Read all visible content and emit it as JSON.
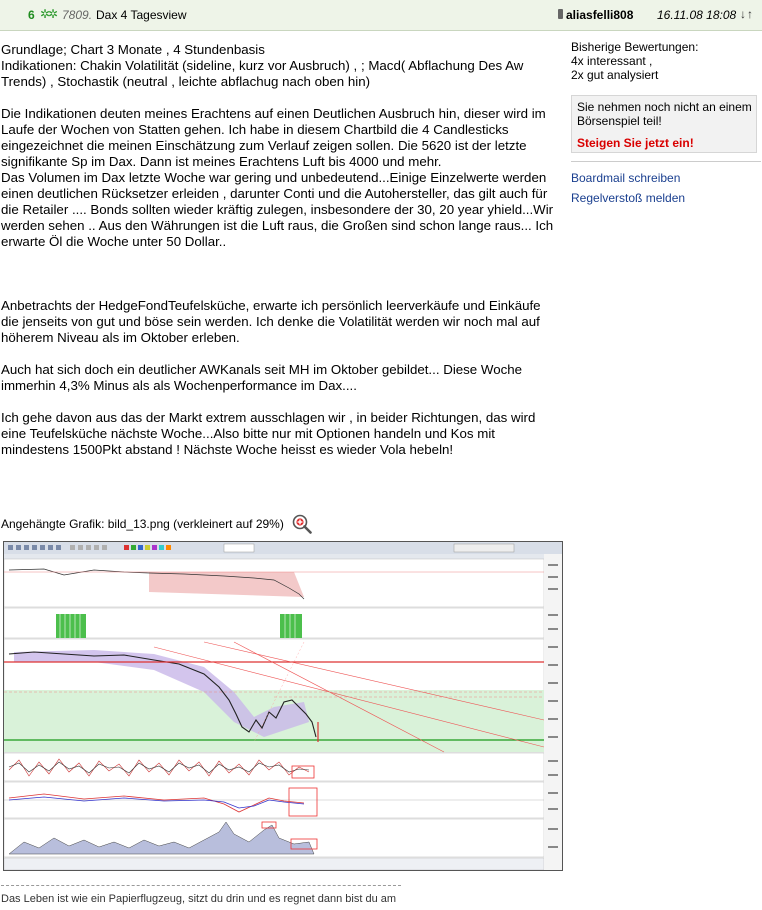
{
  "header": {
    "number": "6",
    "post_id": "7809.",
    "title": "Dax 4 Tagesview",
    "user": "aliasfelli808",
    "date": "16.11.08 18:08",
    "arrows": "↓↑"
  },
  "post": {
    "paragraphs": [
      "Grundlage; Chart 3 Monate , 4 Stundenbasis\nIndikationen: Chakin Volatilität (sideline, kurz vor Ausbruch) , ; Macd( Abflachung Des Aw Trends) , Stochastik (neutral , leichte abflachug nach oben hin)",
      "Die Indikationen deuten meines Erachtens auf einen Deutlichen Ausbruch hin, dieser wird im Laufe der Wochen von Statten gehen. Ich habe in diesem Chartbild die 4 Candlesticks eingezeichnet die meinen Einschätzung zum Verlauf zeigen sollen. Die 5620 ist der letzte signifikante Sp im Dax. Dann ist meines Erachtens Luft bis 4000 und mehr.\nDas Volumen im Dax letzte Woche war gering und unbedeutend...Einige Einzelwerte werden einen deutlichen Rücksetzer erleiden , darunter Conti und die Autohersteller, das gilt auch für die Retailer .... Bonds sollten wieder kräftig zulegen, insbesondere der 30, 20 year yhield...Wir werden sehen .. Aus den Währungen ist die Luft raus, die Großen sind schon lange raus... Ich erwarte Öl die Woche unter 50 Dollar..",
      "",
      "Anbetrachts der HedgeFondTeufelsküche, erwarte ich persönlich leerverkäufe und Einkäufe die jenseits von gut und böse sein werden. Ich denke die Volatilität werden wir noch mal auf höherem Niveau als im Oktober erleben.",
      "Auch hat sich doch ein deutlicher AWKanals seit MH im Oktober gebildet... Diese Woche immerhin 4,3% Minus als als Wochenperformance im Dax....",
      "Ich gehe davon aus das der Markt extrem ausschlagen wir , in beider Richtungen, das wird eine Teufelsküche nächste Woche...Also bitte nur mit Optionen handeln und Kos mit mindestens 1500Pkt abstand ! Nächste Woche heisst es wieder Vola hebeln!"
    ],
    "attachment": "Angehängte Grafik: bild_13.png (verkleinert auf 29%)",
    "signature": "Das Leben ist wie ein Papierflugzeug, sitzt du drin und es regnet dann bist du am"
  },
  "sidebar": {
    "rating_title": "Bisherige Bewertungen:",
    "rating_1": "4x interessant ,",
    "rating_2": "2x gut analysiert",
    "promo_text": "Sie nehmen noch nicht an einem Börsenspiel teil!",
    "promo_cta": "Steigen Sie jetzt ein!",
    "link_board": "Boardmail schreiben",
    "link_report": "Regelverstoß melden"
  },
  "colors": {
    "header_bg": "#eef4e8",
    "accent_green": "#1f8c1f",
    "cta_red": "#d90000",
    "link_blue": "#1a3f8f"
  }
}
